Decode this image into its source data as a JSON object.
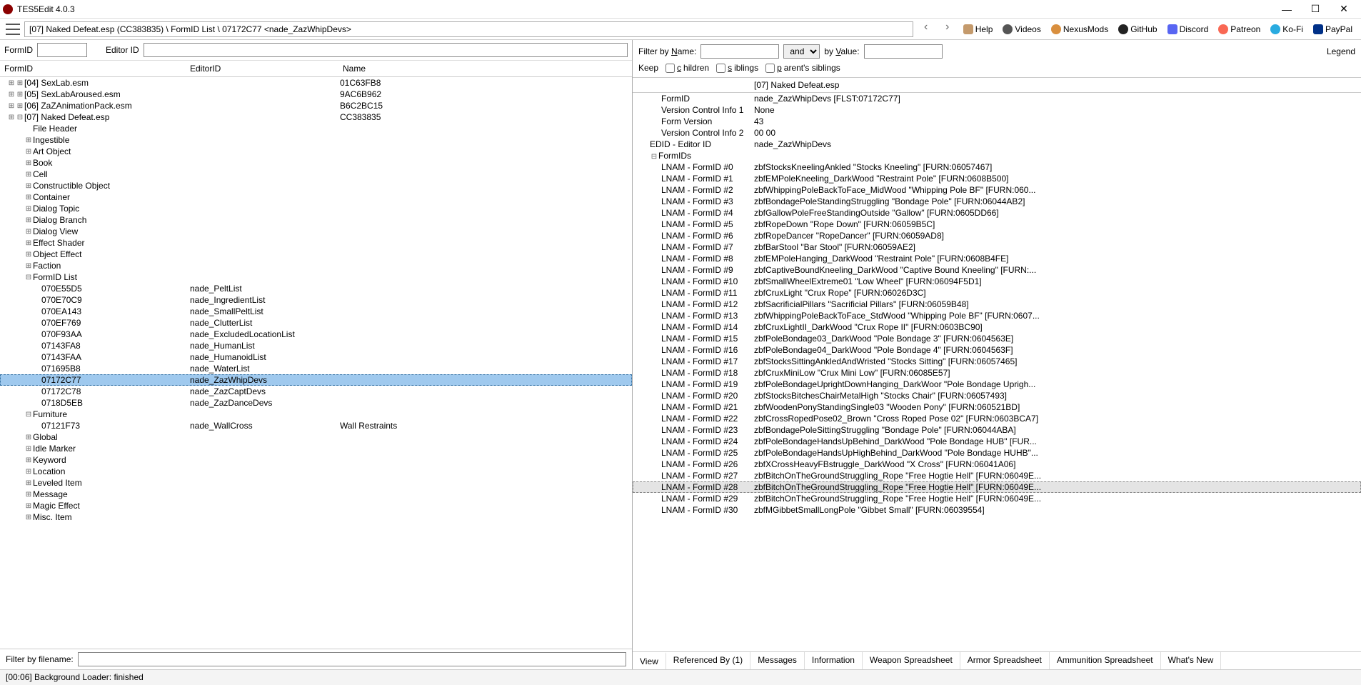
{
  "title": "TES5Edit 4.0.3",
  "breadcrumb": "[07] Naked Defeat.esp (CC383835) \\ FormID List \\ 07172C77 <nade_ZazWhipDevs>",
  "links": {
    "help": "Help",
    "videos": "Videos",
    "nexus": "NexusMods",
    "github": "GitHub",
    "discord": "Discord",
    "patreon": "Patreon",
    "kofi": "Ko-Fi",
    "paypal": "PayPal"
  },
  "id_labels": {
    "formid": "FormID",
    "editorid": "Editor ID"
  },
  "tree_headers": {
    "formid": "FormID",
    "editorid": "EditorID",
    "name": "Name"
  },
  "plugins": [
    {
      "label": "[04] SexLab.esm",
      "name": "01C63FB8"
    },
    {
      "label": "[05] SexLabAroused.esm",
      "name": "9AC6B962"
    },
    {
      "label": "[06] ZaZAnimationPack.esm",
      "name": "B6C2BC15"
    },
    {
      "label": "[07] Naked Defeat.esp",
      "name": "CC383835"
    }
  ],
  "categories_before": [
    "File Header",
    "Ingestible",
    "Art Object",
    "Book",
    "Cell",
    "Constructible Object",
    "Container",
    "Dialog Topic",
    "Dialog Branch",
    "Dialog View",
    "Effect Shader",
    "Object Effect",
    "Faction",
    "FormID List"
  ],
  "formid_list": [
    {
      "id": "070E55D5",
      "editor": "nade_PeltList"
    },
    {
      "id": "070E70C9",
      "editor": "nade_IngredientList"
    },
    {
      "id": "070EA143",
      "editor": "nade_SmallPeltList"
    },
    {
      "id": "070EF769",
      "editor": "nade_ClutterList"
    },
    {
      "id": "070F93AA",
      "editor": "nade_ExcludedLocationList"
    },
    {
      "id": "07143FA8",
      "editor": "nade_HumanList"
    },
    {
      "id": "07143FAA",
      "editor": "nade_HumanoidList"
    },
    {
      "id": "071695B8",
      "editor": "nade_WaterList"
    },
    {
      "id": "07172C77",
      "editor": "nade_ZazWhipDevs",
      "sel": true
    },
    {
      "id": "07172C78",
      "editor": "nade_ZazCaptDevs"
    },
    {
      "id": "0718D5EB",
      "editor": "nade_ZazDanceDevs"
    }
  ],
  "furniture_label": "Furniture",
  "furniture": [
    {
      "id": "07121F73",
      "editor": "nade_WallCross",
      "name": "Wall Restraints"
    }
  ],
  "categories_after": [
    "Global",
    "Idle Marker",
    "Keyword",
    "Location",
    "Leveled Item",
    "Message",
    "Magic Effect",
    "Misc. Item"
  ],
  "filter_label": "Filter by filename:",
  "right_filter": {
    "by_name": "Filter by Name:",
    "and": "and",
    "by_value": "by Value:",
    "legend": "Legend",
    "keep": "Keep",
    "children": "children",
    "siblings": "siblings",
    "parents": "parent's siblings"
  },
  "right_header": "[07] Naked Defeat.esp",
  "details_top": [
    {
      "lbl": "FormID",
      "val": "nade_ZazWhipDevs [FLST:07172C77]",
      "ind": 40
    },
    {
      "lbl": "Version Control Info 1",
      "val": "None",
      "ind": 40
    },
    {
      "lbl": "Form Version",
      "val": "43",
      "ind": 40
    },
    {
      "lbl": "Version Control Info 2",
      "val": "00 00",
      "ind": 40
    },
    {
      "lbl": "EDID - Editor ID",
      "val": "nade_ZazWhipDevs",
      "ind": 24
    },
    {
      "lbl": "FormIDs",
      "val": "",
      "ind": 24,
      "tw": "−"
    }
  ],
  "lnams": [
    "zbfStocksKneelingAnkled \"Stocks Kneeling\" [FURN:06057467]",
    "zbfEMPoleKneeling_DarkWood \"Restraint Pole\" [FURN:0608B500]",
    "zbfWhippingPoleBackToFace_MidWood \"Whipping Pole BF\" [FURN:060...",
    "zbfBondagePoleStandingStruggling \"Bondage Pole\" [FURN:06044AB2]",
    "zbfGallowPoleFreeStandingOutside \"Gallow\" [FURN:0605DD66]",
    "zbfRopeDown \"Rope Down\" [FURN:06059B5C]",
    "zbfRopeDancer \"RopeDancer\" [FURN:06059AD8]",
    "zbfBarStool \"Bar Stool\" [FURN:06059AE2]",
    "zbfEMPoleHanging_DarkWood \"Restraint Pole\" [FURN:0608B4FE]",
    "zbfCaptiveBoundKneeling_DarkWood \"Captive Bound Kneeling\" [FURN:...",
    "zbfSmallWheelExtreme01 \"Low Wheel\" [FURN:06094F5D1]",
    "zbfCruxLight \"Crux Rope\" [FURN:06026D3C]",
    "zbfSacrificialPillars \"Sacrificial Pillars\" [FURN:06059B48]",
    "zbfWhippingPoleBackToFace_StdWood \"Whipping Pole BF\" [FURN:0607...",
    "zbfCruxLightII_DarkWood \"Crux Rope II\" [FURN:0603BC90]",
    "zbfPoleBondage03_DarkWood \"Pole Bondage 3\" [FURN:0604563E]",
    "zbfPoleBondage04_DarkWood \"Pole Bondage 4\" [FURN:0604563F]",
    "zbfStocksSittingAnkledAndWristed \"Stocks Sitting\" [FURN:06057465]",
    "zbfCruxMiniLow \"Crux Mini Low\" [FURN:06085E57]",
    "zbfPoleBondageUprightDownHanging_DarkWoor \"Pole Bondage Uprigh...",
    "zbfStocksBitchesChairMetalHigh \"Stocks Chair\" [FURN:06057493]",
    "zbfWoodenPonyStandingSingle03 \"Wooden Pony\" [FURN:060521BD]",
    "zbfCrossRopedPose02_Brown \"Cross Roped Pose 02\" [FURN:0603BCA7]",
    "zbfBondagePoleSittingStruggling \"Bondage Pole\" [FURN:06044ABA]",
    "zbfPoleBondageHandsUpBehind_DarkWood \"Pole Bondage HUB\" [FUR...",
    "zbfPoleBondageHandsUpHighBehind_DarkWood \"Pole Bondage HUHB\"...",
    "zbfXCrossHeavyFBstruggle_DarkWood \"X Cross\" [FURN:06041A06]",
    "zbfBitchOnTheGroundStruggling_Rope \"Free Hogtie Hell\" [FURN:06049E...",
    "zbfBitchOnTheGroundStruggling_Rope \"Free Hogtie Hell\" [FURN:06049E...",
    "zbfBitchOnTheGroundStruggling_Rope \"Free Hogtie Hell\" [FURN:06049E...",
    "zbfMGibbetSmallLongPole \"Gibbet Small\" [FURN:06039554]"
  ],
  "lnam_sel": 28,
  "tabs": [
    "View",
    "Referenced By (1)",
    "Messages",
    "Information",
    "Weapon Spreadsheet",
    "Armor Spreadsheet",
    "Ammunition Spreadsheet",
    "What's New"
  ],
  "active_tab": 0,
  "status": "[00:06] Background Loader: finished"
}
